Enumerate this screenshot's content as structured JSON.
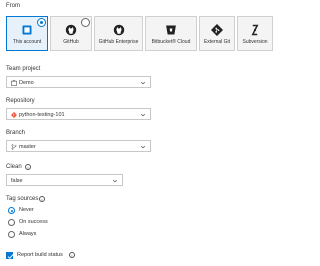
{
  "from": {
    "label": "From",
    "sources": [
      {
        "label": "This account",
        "icon": "azure-repos-icon",
        "selected": true
      },
      {
        "label": "GitHub",
        "icon": "github-icon",
        "selected": false
      },
      {
        "label": "GitHub Enterprise",
        "icon": "github-icon",
        "selected": false
      },
      {
        "label": "Bitbucket® Cloud",
        "icon": "bitbucket-icon",
        "selected": false
      },
      {
        "label": "External Git",
        "icon": "git-icon",
        "selected": false
      },
      {
        "label": "Subversion",
        "icon": "subversion-icon",
        "selected": false
      }
    ]
  },
  "team_project": {
    "label": "Team project",
    "value": "Demo",
    "icon": "project-icon"
  },
  "repository": {
    "label": "Repository",
    "value": "python-testing-101",
    "icon": "git-repo-icon"
  },
  "branch": {
    "label": "Branch",
    "value": "master",
    "icon": "branch-icon"
  },
  "clean": {
    "label": "Clean",
    "value": "false"
  },
  "tag_sources": {
    "label": "Tag sources",
    "options": [
      {
        "label": "Never",
        "checked": true
      },
      {
        "label": "On success",
        "checked": false
      },
      {
        "label": "Always",
        "checked": false
      }
    ]
  },
  "report_build_status": {
    "label": "Report build status",
    "checked": true
  },
  "colors": {
    "accent": "#0078d4",
    "git_orange": "#f05133"
  }
}
